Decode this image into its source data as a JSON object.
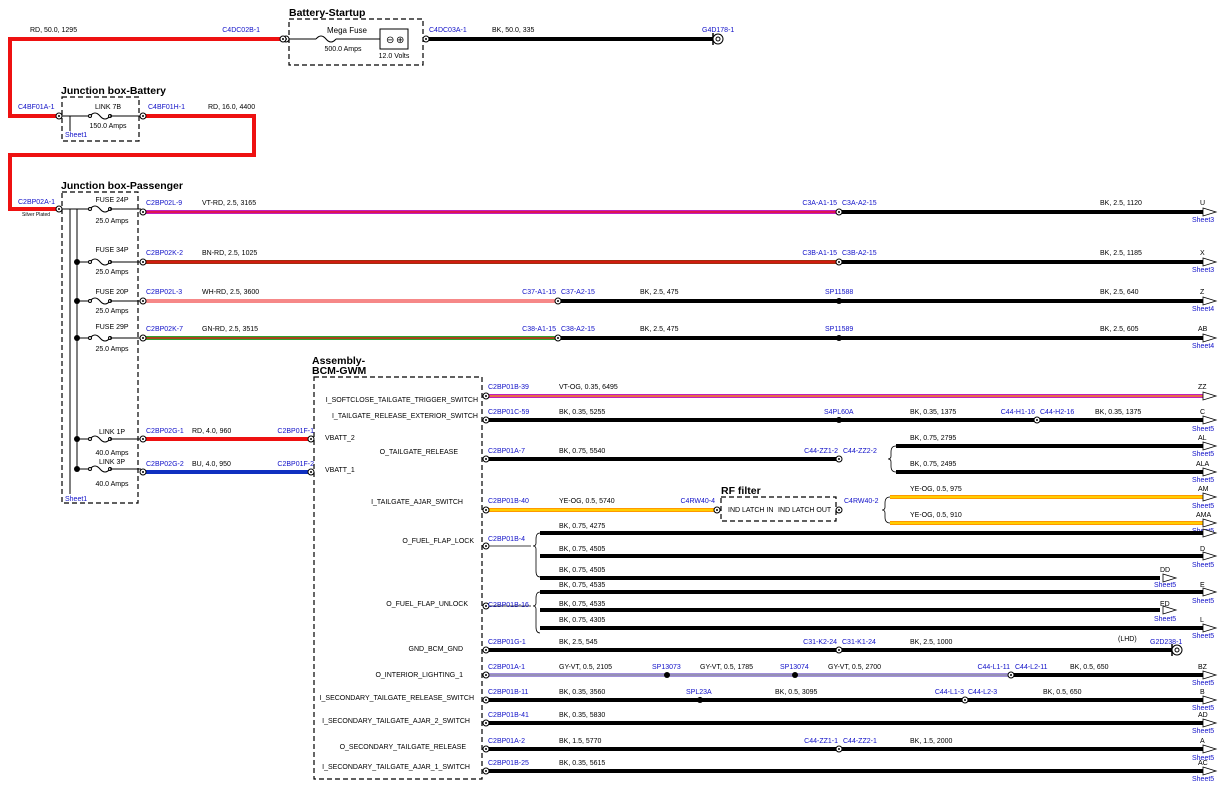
{
  "blocks": {
    "battery": "Battery-Startup",
    "jbb": "Junction box-Battery",
    "jbp": "Junction box-Passenger",
    "bcm1": "Assembly-",
    "bcm2": "BCM-GWM",
    "rf": "RF filter"
  },
  "components": {
    "mega_fuse": "Mega Fuse",
    "mega_fuse_rating": "500.0 Amps",
    "battery_volts": "12.0 Volts",
    "link_7b": "LINK 7B",
    "link_7b_rating": "150.0 Amps",
    "fuse_24p": "FUSE 24P",
    "fuse_24p_rating": "25.0 Amps",
    "fuse_34p": "FUSE 34P",
    "fuse_34p_rating": "25.0 Amps",
    "fuse_20p": "FUSE 20P",
    "fuse_20p_rating": "25.0 Amps",
    "fuse_29p": "FUSE 29P",
    "fuse_29p_rating": "25.0 Amps",
    "link_1p": "LINK 1P",
    "link_1p_rating": "40.0 Amps",
    "link_3p": "LINK 3P",
    "link_3p_rating": "40.0 Amps",
    "silver_plated": "Silver Plated",
    "rf_in": "IND LATCH IN",
    "rf_out": "IND LATCH OUT",
    "lhd": "(LHD)"
  },
  "connectors": {
    "c4dc02b": "C4DC02B-1",
    "c4dc03a": "C4DC03A-1",
    "g4d178": "G4D178-1",
    "c4bf01a": "C4BF01A-1",
    "c4bf01h": "C4BF01H-1",
    "c2bp02a": "C2BP02A-1",
    "c2bp02l9": "C2BP02L-9",
    "c3a_a1": "C3A-A1-15",
    "c3a_a2": "C3A-A2-15",
    "c2bp02k2": "C2BP02K-2",
    "c3b_a1": "C3B-A1-15",
    "c3b_a2": "C3B-A2-15",
    "c2bp02l3": "C2BP02L-3",
    "c37_a1": "C37-A1-15",
    "c37_a2": "C37-A2-15",
    "sp11588": "SP11588",
    "c2bp02k7": "C2BP02K-7",
    "c38_a1": "C38-A1-15",
    "c38_a2": "C38-A2-15",
    "sp11589": "SP11589",
    "c2bp02g1": "C2BP02G-1",
    "c2bp01f1": "C2BP01F-1",
    "c2bp02g2": "C2BP02G-2",
    "c2bp01f2": "C2BP01F-2",
    "c2bp01b39": "C2BP01B-39",
    "c2bp01c59": "C2BP01C-59",
    "s4pl60a": "S4PL60A",
    "c44_h1": "C44-H1-16",
    "c44_h2": "C44-H2-16",
    "c2bp01a7": "C2BP01A-7",
    "c44_zz1_2": "C44-ZZ1-2",
    "c44_zz2_2": "C44-ZZ2-2",
    "c2bp01b40": "C2BP01B-40",
    "c4rw40_4": "C4RW40-4",
    "c4rw40_2": "C4RW40-2",
    "c2bp01b4": "C2BP01B-4",
    "c2bp01b16": "C2BP01B-16",
    "c2bp01g1": "C2BP01G-1",
    "c31_k2": "C31-K2-24",
    "c31_k1": "C31-K1-24",
    "g2d238": "G2D238-1",
    "c2bp01a1": "C2BP01A-1",
    "sp13073": "SP13073",
    "sp13074": "SP13074",
    "c44_l1_11": "C44-L1-11",
    "c44_l2_11": "C44-L2-11",
    "c2bp01b11": "C2BP01B-11",
    "spl23a": "SPL23A",
    "c44_l1_3": "C44-L1-3",
    "c44_l2_3": "C44-L2-3",
    "c2bp01b41": "C2BP01B-41",
    "c2bp01a2": "C2BP01A-2",
    "c44_zz1_1": "C44-ZZ1-1",
    "c44_zz2_1": "C44-ZZ2-1",
    "c2bp01b25": "C2BP01B-25"
  },
  "wires": {
    "w1": "RD, 50.0, 1295",
    "w2": "BK, 50.0, 335",
    "w3": "RD, 16.0, 4400",
    "w4": "VT-RD, 2.5, 3165",
    "w5": "BK, 2.5, 1120",
    "w6": "BN-RD, 2.5, 1025",
    "w7": "BK, 2.5, 1185",
    "w8": "WH-RD, 2.5, 3600",
    "w9": "BK, 2.5, 475",
    "w10": "BK, 2.5, 640",
    "w11": "GN-RD, 2.5, 3515",
    "w12": "BK, 2.5, 475",
    "w13": "BK, 2.5, 605",
    "w14": "RD, 4.0, 960",
    "w15": "BU, 4.0, 950",
    "w16": "VT-OG, 0.35, 6495",
    "w17": "BK, 0.35, 5255",
    "w18": "BK, 0.35, 1375",
    "w19": "BK, 0.35, 1375",
    "w20": "BK, 0.75, 5540",
    "w21": "BK, 0.75, 2795",
    "w22": "BK, 0.75, 2495",
    "w23": "YE-OG, 0.5, 5740",
    "w24": "YE-OG, 0.5, 975",
    "w25": "YE-OG, 0.5, 910",
    "w26": "BK, 0.75, 4275",
    "w27": "BK, 0.75, 4505",
    "w28": "BK, 0.75, 4505",
    "w29": "BK, 0.75, 4535",
    "w30": "BK, 0.75, 4535",
    "w31": "BK, 0.75, 4305",
    "w32": "BK, 2.5, 545",
    "w33": "BK, 2.5, 1000",
    "w34": "GY-VT, 0.5, 2105",
    "w35": "GY-VT, 0.5, 1785",
    "w36": "GY-VT, 0.5, 2700",
    "w37": "BK, 0.5, 650",
    "w38": "BK, 0.35, 3560",
    "w39": "BK, 0.5, 3095",
    "w40": "BK, 0.5, 650",
    "w41": "BK, 0.35, 5830",
    "w42": "BK, 1.5, 5770",
    "w43": "BK, 1.5, 2000",
    "w44": "BK, 0.35, 5615"
  },
  "signals": {
    "vbatt2": "VBATT_2",
    "vbatt1": "VBATT_1",
    "s1": "I_SOFTCLOSE_TAILGATE_TRIGGER_SWITCH",
    "s2": "I_TAILGATE_RELEASE_EXTERIOR_SWITCH",
    "s3": "O_TAILGATE_RELEASE",
    "s4": "I_TAILGATE_AJAR_SWITCH",
    "s5": "O_FUEL_FLAP_LOCK",
    "s6": "O_FUEL_FLAP_UNLOCK",
    "s7": "GND_BCM_GND",
    "s8": "O_INTERIOR_LIGHTING_1",
    "s9": "I_SECONDARY_TAILGATE_RELEASE_SWITCH",
    "s10": "I_SECONDARY_TAILGATE_AJAR_2_SWITCH",
    "s11": "O_SECONDARY_TAILGATE_RELEASE",
    "s12": "I_SECONDARY_TAILGATE_AJAR_1_SWITCH"
  },
  "off_sheet": {
    "u": "U",
    "x": "X",
    "z": "Z",
    "ab": "AB",
    "zz": "ZZ",
    "c": "C",
    "al": "AL",
    "ala": "ALA",
    "am": "AM",
    "ama": "AMA",
    "dd": "DD",
    "d": "D",
    "e": "E",
    "ed": "ED",
    "l": "L",
    "bz": "BZ",
    "b": "B",
    "ad": "AD",
    "a": "A",
    "ac": "AC"
  },
  "sheets": {
    "sheet1": "Sheet1",
    "sheet3": "Sheet3",
    "sheet4": "Sheet4",
    "sheet5": "Sheet5"
  },
  "colors": {
    "red": "#ee1111",
    "black": "#000000",
    "violet": "#c020c0",
    "brown": "#a03010",
    "white": "#ffffff",
    "green": "#30a030",
    "blue": "#1030c0",
    "orange": "#ff9900",
    "yellow": "#ffee00",
    "grey": "#9090a0",
    "link_blue": "#1010c8"
  }
}
